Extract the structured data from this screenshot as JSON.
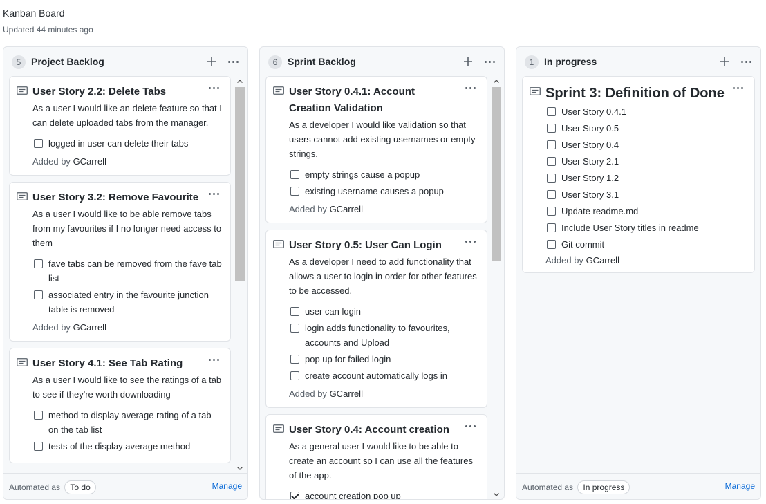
{
  "board": {
    "title": "Kanban Board",
    "updated": "Updated 44 minutes ago"
  },
  "columns": [
    {
      "count": "5",
      "title": "Project Backlog",
      "automated_prefix": "Automated as",
      "automated_value": "To do",
      "manage": "Manage",
      "cards": [
        {
          "title": "User Story 2.2: Delete Tabs",
          "description": "As a user I would like an delete feature so that I can delete uploaded tabs from the manager.",
          "checklist": [
            {
              "text": "logged in user can delete their tabs",
              "checked": false
            }
          ],
          "added_prefix": "Added by",
          "author": "GCarrell"
        },
        {
          "title": "User Story 3.2: Remove Favourite",
          "description": "As a user I would like to be able remove tabs from my favourites if I no longer need access to them",
          "checklist": [
            {
              "text": "fave tabs can be removed from the fave tab list",
              "checked": false
            },
            {
              "text": "associated entry in the favourite junction table is removed",
              "checked": false
            }
          ],
          "added_prefix": "Added by",
          "author": "GCarrell"
        },
        {
          "title": "User Story 4.1: See Tab Rating",
          "description": "As a user I would like to see the ratings of a tab to see if they're worth downloading",
          "checklist": [
            {
              "text": "method to display average rating of a tab on the tab list",
              "checked": false
            },
            {
              "text": "tests of the display average method",
              "checked": false
            }
          ]
        }
      ]
    },
    {
      "count": "6",
      "title": "Sprint Backlog",
      "cards": [
        {
          "title": "User Story 0.4.1: Account Creation Validation",
          "description": "As a developer I would like validation so that users cannot add existing usernames or empty strings.",
          "checklist": [
            {
              "text": "empty strings cause a popup",
              "checked": false
            },
            {
              "text": "existing username causes a popup",
              "checked": false
            }
          ],
          "added_prefix": "Added by",
          "author": "GCarrell"
        },
        {
          "title": "User Story 0.5: User Can Login",
          "description": "As a developer I need to add functionality that allows a user to login in order for other features to be accessed.",
          "checklist": [
            {
              "text": "user can login",
              "checked": false
            },
            {
              "text": "login adds functionality to favourites, accounts and Upload",
              "checked": false
            },
            {
              "text": "pop up for failed login",
              "checked": false
            },
            {
              "text": "create account automatically logs in",
              "checked": false
            }
          ],
          "added_prefix": "Added by",
          "author": "GCarrell"
        },
        {
          "title": "User Story 0.4: Account creation",
          "description": "As a general user I would like to be able to create an account so I can use all the features of the app.",
          "checklist": [
            {
              "text": "account creation pop up",
              "checked": true
            }
          ]
        }
      ]
    },
    {
      "count": "1",
      "title": "In progress",
      "automated_prefix": "Automated as",
      "automated_value": "In progress",
      "manage": "Manage",
      "cards": [
        {
          "title": "Sprint 3: Definition of Done",
          "checklist": [
            {
              "text": "User Story 0.4.1",
              "checked": false
            },
            {
              "text": "User Story 0.5",
              "checked": false
            },
            {
              "text": "User Story 0.4",
              "checked": false
            },
            {
              "text": "User Story 2.1",
              "checked": false
            },
            {
              "text": "User Story 1.2",
              "checked": false
            },
            {
              "text": "User Story 3.1",
              "checked": false
            },
            {
              "text": "Update readme.md",
              "checked": false
            },
            {
              "text": "Include User Story titles in readme",
              "checked": false
            },
            {
              "text": "Git commit",
              "checked": false
            }
          ],
          "added_prefix": "Added by",
          "author": "GCarrell"
        }
      ]
    }
  ]
}
